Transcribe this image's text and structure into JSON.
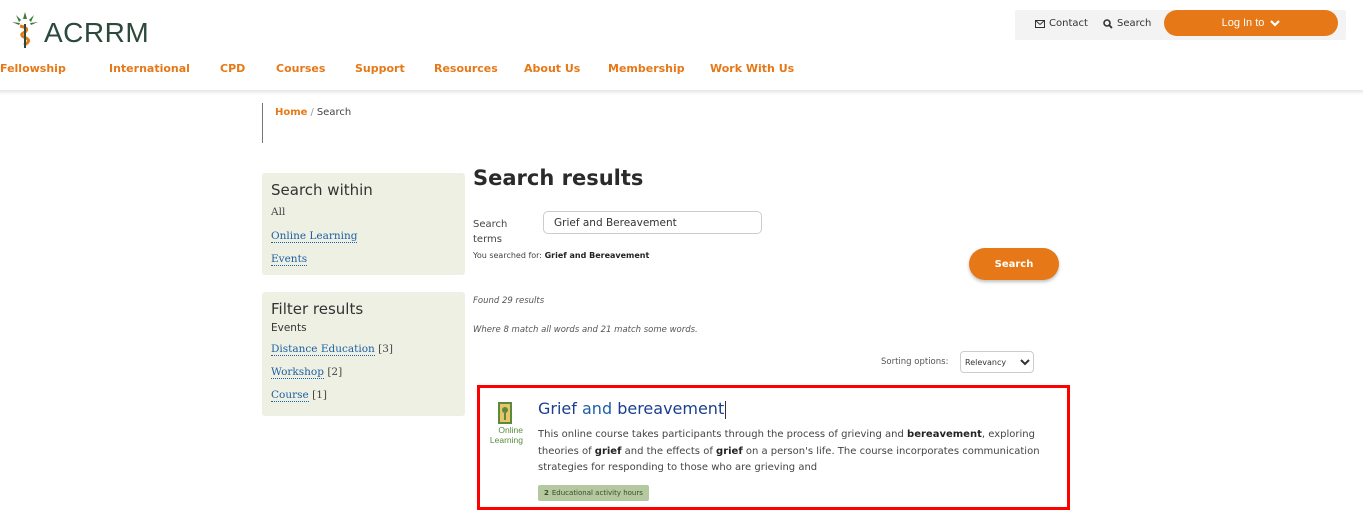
{
  "brand": {
    "name": "ACRRM"
  },
  "topbar": {
    "contact": "Contact",
    "search": "Search",
    "login": "Log In to"
  },
  "nav": [
    "Fellowship",
    "International",
    "CPD",
    "Courses",
    "Support",
    "Resources",
    "About Us",
    "Membership",
    "Work With Us"
  ],
  "breadcrumb": {
    "home": "Home",
    "separator": "/",
    "current": "Search"
  },
  "sidebar": {
    "within": {
      "title": "Search within",
      "items": [
        "All",
        "Online Learning",
        "Events"
      ]
    },
    "filter": {
      "title": "Filter results",
      "subheading": "Events",
      "items": [
        {
          "label": "Distance Education",
          "count": "[3]"
        },
        {
          "label": "Workshop",
          "count": "[2]"
        },
        {
          "label": "Course",
          "count": "[1]"
        }
      ]
    }
  },
  "main": {
    "title": "Search results",
    "terms_label": "Search terms",
    "terms_value": "Grief and Bereavement",
    "searched_prefix": "You searched for:",
    "searched_term": "Grief and Bereavement",
    "search_button": "Search",
    "found": "Found 29 results",
    "match": "Where 8 match all words and 21 match some words.",
    "sort_label": "Sorting options:",
    "sort_value": "Relevancy"
  },
  "result": {
    "type_label": "Online Learning",
    "title_1": "Grief",
    "title_2": " and ",
    "title_3": "bereavement",
    "desc_1": "This online course takes participants through the process of grieving and ",
    "desc_2": "bereavement",
    "desc_3": ", exploring theories of ",
    "desc_4": "grief",
    "desc_5": " and the effects of ",
    "desc_6": "grief",
    "desc_7": " on a person's life. The course incorporates communication strategies for responding to those who are grieving and",
    "badge_count": "2",
    "badge_label": "Educational activity hours"
  },
  "colors": {
    "accent": "#e67817",
    "link": "#1d5fa4",
    "panel": "#eef0e3",
    "highlight_border": "#ff0000",
    "badge": "#b5c9a0"
  }
}
